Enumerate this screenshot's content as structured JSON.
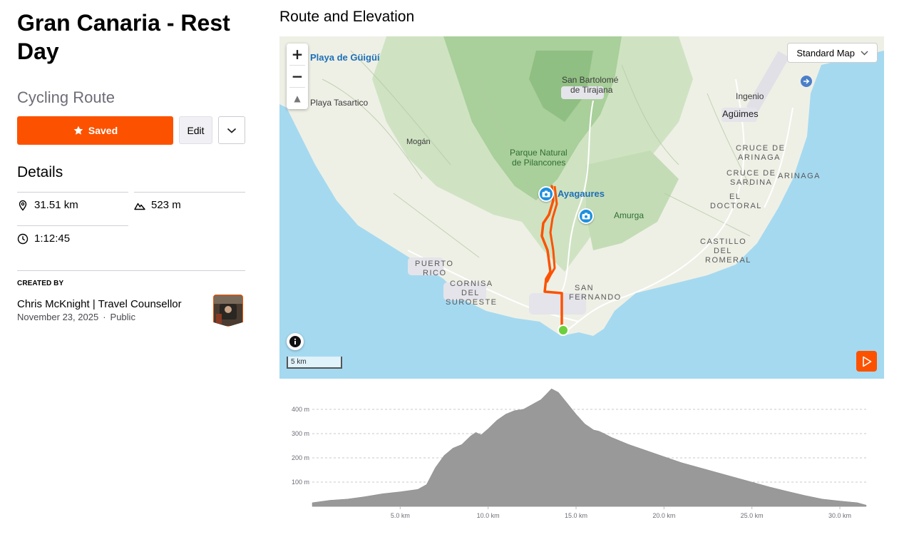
{
  "route": {
    "title": "Gran Canaria - Rest Day",
    "type": "Cycling Route"
  },
  "actions": {
    "saved_label": "Saved",
    "edit_label": "Edit",
    "more_icon": "chevron-down-icon"
  },
  "details": {
    "heading": "Details",
    "distance": "31.51 km",
    "elevation_gain": "523 m",
    "est_time": "1:12:45"
  },
  "creator": {
    "label": "CREATED BY",
    "name": "Chris McKnight | Travel Counsellor",
    "date": "November 23, 2025",
    "separator": "·",
    "visibility": "Public"
  },
  "map": {
    "heading": "Route and Elevation",
    "style_selector": "Standard Map",
    "zoom_in": "+",
    "zoom_out": "−",
    "compass": "▲",
    "scale": "5 km",
    "labels": {
      "playa_guigui": "Playa de Güigüí",
      "playa_tasartico": "Playa Tasartico",
      "san_bartolome_1": "San Bartolomé",
      "san_bartolome_2": "de Tirajana",
      "ingenio": "Ingenio",
      "aguimes": "Agüimes",
      "mogan": "Mogán",
      "parque_1": "Parque Natural",
      "parque_2": "de Pilancones",
      "cruce_arinaga_1": "CRUCE DE",
      "cruce_arinaga_2": "ARINAGA",
      "cruce_sardina_1": "CRUCE DE",
      "cruce_sardina_2": "SARDINA",
      "arinaga": "ARINAGA",
      "el_doctoral_1": "EL",
      "el_doctoral_2": "DOCTORAL",
      "ayagaures": "Ayagaures",
      "amurga": "Amurga",
      "castillo_1": "CASTILLO",
      "castillo_2": "DEL",
      "castillo_3": "ROMERAL",
      "puerto_rico_1": "PUERTO",
      "puerto_rico_2": "RICO",
      "cornisa_1": "CORNISA",
      "cornisa_2": "DEL",
      "cornisa_3": "SUROESTE",
      "san_fernando_1": "SAN",
      "san_fernando_2": "FERNANDO"
    },
    "colors": {
      "route": "#fc5200",
      "water": "#a5d9f0",
      "land": "#eef0e6",
      "start": "#6ccf3c"
    }
  },
  "chart_data": {
    "type": "area",
    "title": "",
    "xlabel": "",
    "ylabel": "",
    "y_ticks": [
      "100 m",
      "200 m",
      "300 m",
      "400 m"
    ],
    "x_ticks": [
      "5.0 km",
      "10.0 km",
      "15.0 km",
      "20.0 km",
      "25.0 km",
      "30.0 km"
    ],
    "xlim": [
      0,
      31.5
    ],
    "ylim": [
      0,
      500
    ],
    "x": [
      0,
      1,
      2,
      3,
      4,
      5,
      6,
      6.5,
      7,
      7.5,
      8,
      8.5,
      9,
      9.3,
      9.6,
      10,
      10.5,
      11,
      11.5,
      12,
      12.5,
      13,
      13.3,
      13.6,
      14,
      14.5,
      15,
      15.5,
      16,
      16.3,
      16.6,
      17,
      18,
      19,
      20,
      21,
      22,
      23,
      24,
      25,
      26,
      27,
      28,
      29,
      30,
      31,
      31.5
    ],
    "y": [
      15,
      25,
      30,
      40,
      52,
      60,
      70,
      90,
      160,
      210,
      240,
      255,
      290,
      305,
      295,
      320,
      355,
      380,
      395,
      400,
      420,
      440,
      462,
      485,
      470,
      425,
      380,
      340,
      315,
      310,
      300,
      285,
      255,
      230,
      205,
      180,
      160,
      140,
      120,
      100,
      80,
      62,
      45,
      30,
      22,
      15,
      5
    ],
    "colors": {
      "fill": "#999999"
    }
  }
}
